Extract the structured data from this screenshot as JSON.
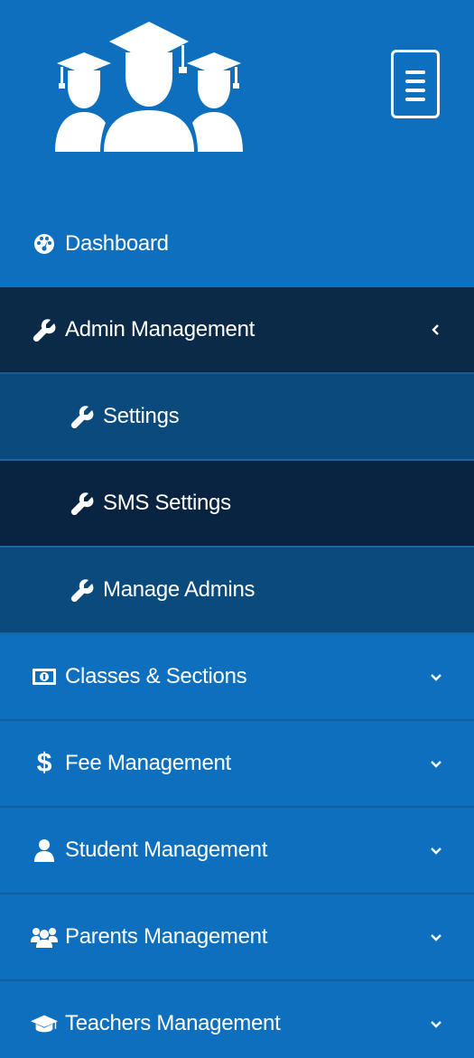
{
  "brand": {
    "logo_icon": "graduates-icon"
  },
  "header": {
    "toggle_icon": "hamburger-icon"
  },
  "menu": {
    "dashboard": {
      "label": "Dashboard",
      "icon": "dashboard-icon"
    },
    "admin_management": {
      "label": "Admin Management",
      "icon": "wrench-icon",
      "expanded": true
    },
    "settings": {
      "label": "Settings",
      "icon": "wrench-icon"
    },
    "sms_settings": {
      "label": "SMS Settings",
      "icon": "wrench-icon",
      "active": true
    },
    "manage_admins": {
      "label": "Manage Admins",
      "icon": "wrench-icon"
    },
    "classes_sections": {
      "label": "Classes & Sections",
      "icon": "money-icon"
    },
    "fee_management": {
      "label": "Fee Management",
      "icon": "dollar-icon",
      "icon_text": "$"
    },
    "student_management": {
      "label": "Student Management",
      "icon": "user-icon"
    },
    "parents_management": {
      "label": "Parents Management",
      "icon": "users-icon"
    },
    "teachers_management": {
      "label": "Teachers Management",
      "icon": "graduation-cap-icon"
    }
  },
  "colors": {
    "sidebar_bg": "#0d6fbd",
    "open_parent_bg": "#0a2a48",
    "submenu_bg": "#0a4a7c",
    "submenu_active_bg": "#082440",
    "text": "#ffffff"
  }
}
